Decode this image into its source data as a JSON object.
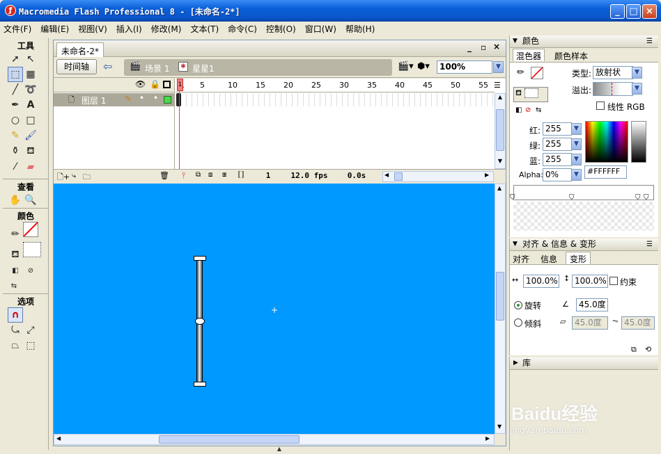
{
  "window": {
    "title": "Macromedia Flash Professional 8 - [未命名-2*]",
    "icon": "flash-icon"
  },
  "menu": [
    "文件(F)",
    "编辑(E)",
    "视图(V)",
    "插入(I)",
    "修改(M)",
    "文本(T)",
    "命令(C)",
    "控制(O)",
    "窗口(W)",
    "帮助(H)"
  ],
  "toolbox": {
    "title": "工具",
    "view": "查看",
    "colors": "颜色",
    "options": "选项"
  },
  "document": {
    "tab": "未命名-2*",
    "timeline_button": "时间轴",
    "scene": "场景 1",
    "symbol": "星星1",
    "zoom": "100%"
  },
  "timeline": {
    "frame_numbers": [
      "1",
      "5",
      "10",
      "15",
      "20",
      "25",
      "30",
      "35",
      "40",
      "45",
      "50",
      "55"
    ],
    "layer_name": "图层 1",
    "current_frame": "1",
    "fps": "12.0 fps",
    "time": "0.0s"
  },
  "color_panel": {
    "title": "颜色",
    "tabs": [
      "混色器",
      "颜色样本"
    ],
    "type_label": "类型:",
    "type_value": "放射状",
    "overflow_label": "溢出:",
    "linear_rgb": "线性 RGB",
    "red_label": "红:",
    "red": "255",
    "green_label": "绿:",
    "green": "255",
    "blue_label": "蓝:",
    "blue": "255",
    "alpha_label": "Alpha:",
    "alpha": "0%",
    "hex": "#FFFFFF"
  },
  "transform_panel": {
    "title": "对齐 & 信息 & 变形",
    "tabs": [
      "对齐",
      "信息",
      "变形"
    ],
    "width_pct": "100.0%",
    "height_pct": "100.0%",
    "constrain": "约束",
    "rotate_label": "旋转",
    "rotate_value": "45.0度",
    "skew_label": "倾斜",
    "skew_h": "45.0度",
    "skew_v": "45.0度"
  },
  "library_panel": {
    "title": "库"
  },
  "watermark": {
    "brand": "Baidu经验",
    "url": "jingyan.baidu.com"
  },
  "colors": {
    "stage": "#0099ff",
    "titlebar": "#0a5fd8",
    "playhead": "#d84040"
  }
}
